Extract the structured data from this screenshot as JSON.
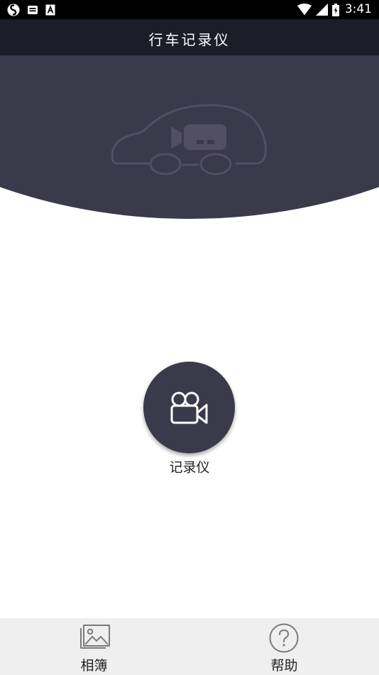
{
  "status_bar": {
    "time": "3:41",
    "left_icons": [
      "sync-icon",
      "mail-icon",
      "font-icon"
    ],
    "right_icons": [
      "wifi-icon",
      "signal-icon",
      "battery-icon"
    ]
  },
  "header": {
    "title": "行车记录仪"
  },
  "main": {
    "recorder_label": "记录仪"
  },
  "bottom_nav": {
    "items": [
      {
        "label": "相簿",
        "icon": "image-icon"
      },
      {
        "label": "帮助",
        "icon": "help-icon"
      }
    ]
  },
  "colors": {
    "status_bar": "#000000",
    "title_bar": "#1b1d28",
    "banner": "#3b3a4b",
    "bottom_nav": "#efefef"
  }
}
